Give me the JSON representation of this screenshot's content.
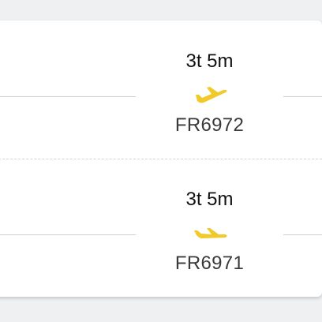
{
  "colors": {
    "accent": "#f0c92b",
    "brand": "#1a3b8f",
    "background": "#eef0f2",
    "card": "#ffffff",
    "line": "#cfcfcf"
  },
  "top_strip": {
    "partial_text": ""
  },
  "legs": [
    {
      "duration": "3t 5m",
      "flight_number": "FR6972",
      "icon": "plane-takeoff-icon"
    },
    {
      "duration": "3t 5m",
      "flight_number": "FR6971",
      "icon": "plane-takeoff-icon"
    }
  ]
}
